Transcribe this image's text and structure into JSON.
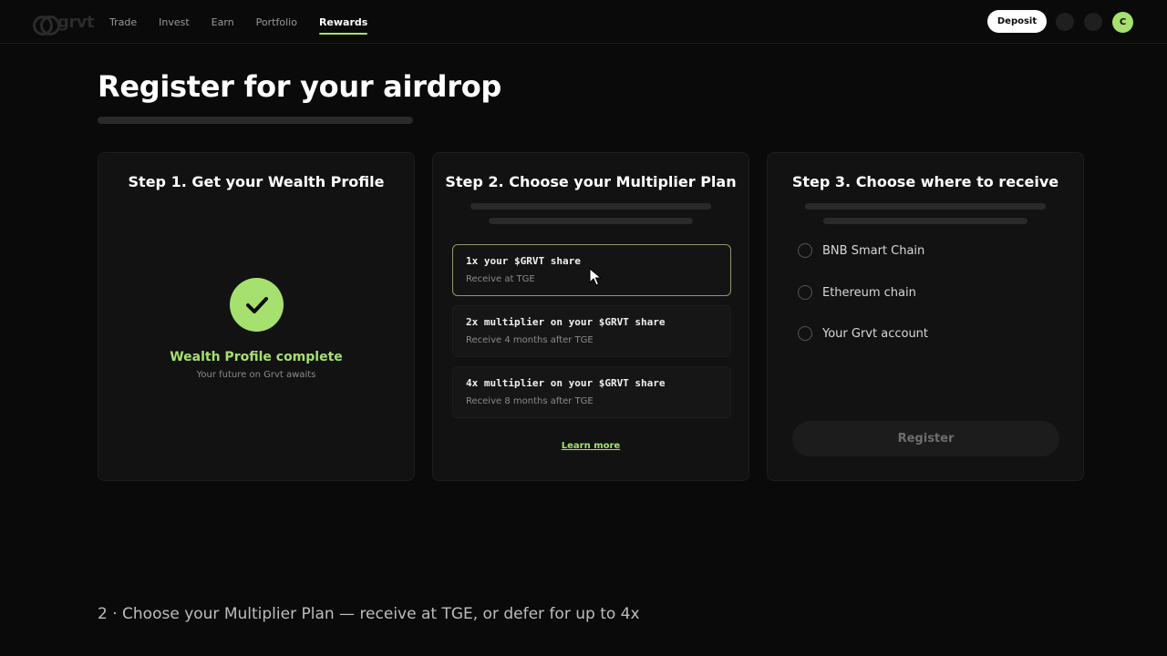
{
  "nav": {
    "logo_text": "grvt",
    "links": [
      {
        "label": "Trade"
      },
      {
        "label": "Invest"
      },
      {
        "label": "Earn"
      },
      {
        "label": "Portfolio"
      },
      {
        "label": "Rewards",
        "active": true
      }
    ],
    "deposit_label": "Deposit",
    "avatar_initial": "C"
  },
  "page": {
    "title": "Register for your airdrop"
  },
  "step1": {
    "title": "Step 1. Get your Wealth Profile",
    "complete_title": "Wealth Profile complete",
    "complete_sub": "Your future on Grvt awaits"
  },
  "step2": {
    "title": "Step 2. Choose your Multiplier Plan",
    "plans": [
      {
        "title": "1x your $GRVT share",
        "sub": "Receive at TGE",
        "selected": true
      },
      {
        "title": "2x multiplier on your $GRVT share",
        "sub": "Receive 4 months after TGE",
        "selected": false
      },
      {
        "title": "4x multiplier on your $GRVT share",
        "sub": "Receive 8 months after TGE",
        "selected": false
      }
    ],
    "learn_more": "Learn more"
  },
  "step3": {
    "title": "Step 3. Choose where to receive",
    "options": [
      {
        "label": "BNB Smart Chain"
      },
      {
        "label": "Ethereum chain"
      },
      {
        "label": "Your Grvt account"
      }
    ],
    "register_label": "Register"
  },
  "caption": "2 · Choose your Multiplier Plan — receive at TGE, or defer for up to 4x",
  "colors": {
    "accent": "#a6e06e",
    "background": "#0a0a0a",
    "card": "#121212"
  }
}
